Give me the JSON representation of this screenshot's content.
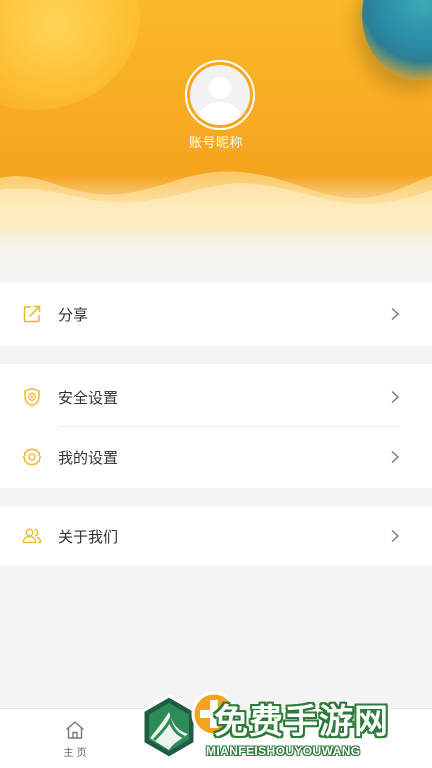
{
  "profile": {
    "nickname": "账号昵称"
  },
  "menu": {
    "share": {
      "label": "分享"
    },
    "security": {
      "label": "安全设置"
    },
    "my_settings": {
      "label": "我的设置"
    },
    "about": {
      "label": "关于我们"
    }
  },
  "tabbar": {
    "home_label": "主 页"
  },
  "watermark": {
    "title": "免费手游网",
    "subtitle": "MIANFEISHOUYOUWANG"
  },
  "colors": {
    "accent": "#f5a31e",
    "icon": "#f0b429",
    "background": "#f4f4f4"
  },
  "icons": {
    "share": "share-icon",
    "security": "shield-icon",
    "settings": "gear-icon",
    "about": "users-icon",
    "home": "home-icon",
    "chevron": "chevron-right-icon"
  }
}
